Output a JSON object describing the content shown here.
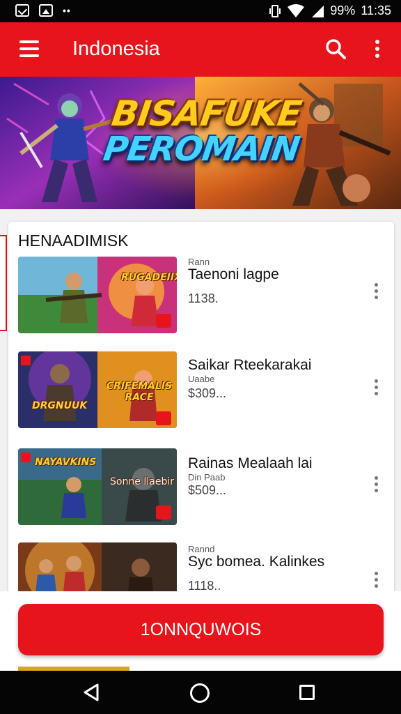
{
  "status_bar": {
    "battery": "99%",
    "time": "11:35",
    "icons": [
      "message-icon",
      "image-icon",
      "dots-icon",
      "vibrate-icon",
      "wifi-icon",
      "signal-icon"
    ]
  },
  "app_bar": {
    "title": "Indonesia",
    "icons": [
      "menu-icon",
      "search-icon",
      "more-vert-icon"
    ],
    "color": "#e8141b"
  },
  "banner": {
    "line1": "BISAFUKE",
    "line2": "PEROMAIN"
  },
  "list": {
    "section_title": "HENAADIMISK",
    "items": [
      {
        "sub": "Rann",
        "name": "Taenoni lagpe",
        "price": "1138.",
        "thumb_caption_left": "",
        "thumb_caption_right": "RUGADEIIX"
      },
      {
        "sub": "Uaabe",
        "name": "Saikar Rteekarakai",
        "price": "$309...",
        "thumb_caption_left": "DRGNUUK",
        "thumb_caption_right": "CRIFEMALIS RACE"
      },
      {
        "sub": "Din Paab",
        "name": "Rainas Mealaah lai",
        "price": "$509...",
        "thumb_caption_left": "NAYAVKINS",
        "thumb_caption_right": "Sonne Ilaebir"
      },
      {
        "sub": "Rannd",
        "name": "Syc bomea. Kalinkes",
        "price": "1118..",
        "thumb_caption_left": "",
        "thumb_caption_right": ""
      }
    ]
  },
  "main_button": {
    "label": "1ONNQUWOIS"
  },
  "nav_bar": {
    "icons": [
      "back-icon",
      "home-icon",
      "recents-icon"
    ]
  }
}
